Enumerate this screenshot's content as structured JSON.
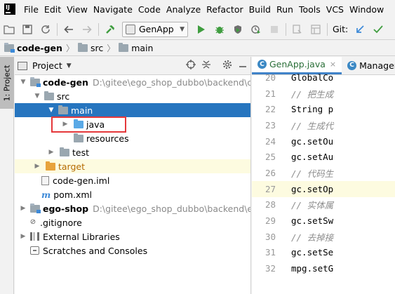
{
  "menu": [
    "File",
    "Edit",
    "View",
    "Navigate",
    "Code",
    "Analyze",
    "Refactor",
    "Build",
    "Run",
    "Tools",
    "VCS",
    "Window"
  ],
  "toolbar": {
    "run_config": "GenApp",
    "git_label": "Git:"
  },
  "breadcrumb": {
    "project": "code-gen",
    "folder1": "src",
    "folder2": "main"
  },
  "side_tab_label": "1: Project",
  "project_panel": {
    "title": "Project"
  },
  "tree": {
    "code_gen": {
      "name": "code-gen",
      "path": "D:\\gitee\\ego_shop_dubbo\\backend\\code-gen"
    },
    "src": "src",
    "main": "main",
    "java": "java",
    "resources": "resources",
    "test": "test",
    "target": "target",
    "iml": "code-gen.iml",
    "pom": "pom.xml",
    "ego_shop": {
      "name": "ego-shop",
      "path": "D:\\gitee\\ego_shop_dubbo\\backend\\ego-shop"
    },
    "gitignore": ".gitignore",
    "external_libs": "External Libraries",
    "scratches": "Scratches and Consoles"
  },
  "editor": {
    "tabs": [
      {
        "label": "GenApp.java",
        "active": true
      },
      {
        "label": "ManagerA",
        "active": false
      }
    ],
    "lines": [
      {
        "num": "20",
        "text": "GlobalCo",
        "comment": false
      },
      {
        "num": "21",
        "text": "// 把生成",
        "comment": true
      },
      {
        "num": "22",
        "text": "String p",
        "comment": false
      },
      {
        "num": "23",
        "text": "// 生成代",
        "comment": true
      },
      {
        "num": "24",
        "text": "gc.setOu",
        "comment": false
      },
      {
        "num": "25",
        "text": "gc.setAu",
        "comment": false
      },
      {
        "num": "26",
        "text": "// 代码生",
        "comment": true
      },
      {
        "num": "27",
        "text": "gc.setOp",
        "comment": false
      },
      {
        "num": "28",
        "text": "// 实体属",
        "comment": true
      },
      {
        "num": "29",
        "text": "gc.setSw",
        "comment": false
      },
      {
        "num": "30",
        "text": "// 去掉接",
        "comment": true
      },
      {
        "num": "31",
        "text": "gc.setSe",
        "comment": false
      },
      {
        "num": "32",
        "text": "mpg.setG",
        "comment": false
      }
    ],
    "current_line": "27"
  }
}
